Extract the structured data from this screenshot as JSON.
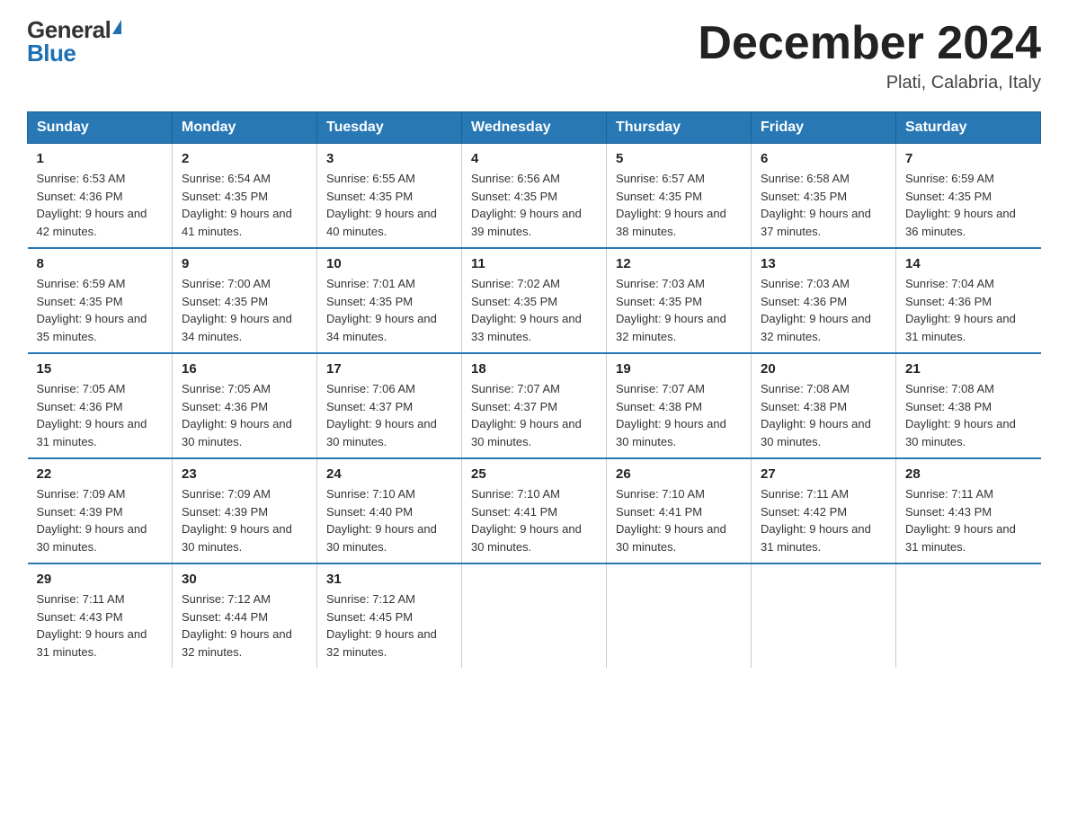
{
  "header": {
    "logo_general": "General",
    "logo_blue": "Blue",
    "month_title": "December 2024",
    "location": "Plati, Calabria, Italy"
  },
  "weekdays": [
    "Sunday",
    "Monday",
    "Tuesday",
    "Wednesday",
    "Thursday",
    "Friday",
    "Saturday"
  ],
  "weeks": [
    [
      {
        "day": "1",
        "sunrise": "6:53 AM",
        "sunset": "4:36 PM",
        "daylight": "9 hours and 42 minutes."
      },
      {
        "day": "2",
        "sunrise": "6:54 AM",
        "sunset": "4:35 PM",
        "daylight": "9 hours and 41 minutes."
      },
      {
        "day": "3",
        "sunrise": "6:55 AM",
        "sunset": "4:35 PM",
        "daylight": "9 hours and 40 minutes."
      },
      {
        "day": "4",
        "sunrise": "6:56 AM",
        "sunset": "4:35 PM",
        "daylight": "9 hours and 39 minutes."
      },
      {
        "day": "5",
        "sunrise": "6:57 AM",
        "sunset": "4:35 PM",
        "daylight": "9 hours and 38 minutes."
      },
      {
        "day": "6",
        "sunrise": "6:58 AM",
        "sunset": "4:35 PM",
        "daylight": "9 hours and 37 minutes."
      },
      {
        "day": "7",
        "sunrise": "6:59 AM",
        "sunset": "4:35 PM",
        "daylight": "9 hours and 36 minutes."
      }
    ],
    [
      {
        "day": "8",
        "sunrise": "6:59 AM",
        "sunset": "4:35 PM",
        "daylight": "9 hours and 35 minutes."
      },
      {
        "day": "9",
        "sunrise": "7:00 AM",
        "sunset": "4:35 PM",
        "daylight": "9 hours and 34 minutes."
      },
      {
        "day": "10",
        "sunrise": "7:01 AM",
        "sunset": "4:35 PM",
        "daylight": "9 hours and 34 minutes."
      },
      {
        "day": "11",
        "sunrise": "7:02 AM",
        "sunset": "4:35 PM",
        "daylight": "9 hours and 33 minutes."
      },
      {
        "day": "12",
        "sunrise": "7:03 AM",
        "sunset": "4:35 PM",
        "daylight": "9 hours and 32 minutes."
      },
      {
        "day": "13",
        "sunrise": "7:03 AM",
        "sunset": "4:36 PM",
        "daylight": "9 hours and 32 minutes."
      },
      {
        "day": "14",
        "sunrise": "7:04 AM",
        "sunset": "4:36 PM",
        "daylight": "9 hours and 31 minutes."
      }
    ],
    [
      {
        "day": "15",
        "sunrise": "7:05 AM",
        "sunset": "4:36 PM",
        "daylight": "9 hours and 31 minutes."
      },
      {
        "day": "16",
        "sunrise": "7:05 AM",
        "sunset": "4:36 PM",
        "daylight": "9 hours and 30 minutes."
      },
      {
        "day": "17",
        "sunrise": "7:06 AM",
        "sunset": "4:37 PM",
        "daylight": "9 hours and 30 minutes."
      },
      {
        "day": "18",
        "sunrise": "7:07 AM",
        "sunset": "4:37 PM",
        "daylight": "9 hours and 30 minutes."
      },
      {
        "day": "19",
        "sunrise": "7:07 AM",
        "sunset": "4:38 PM",
        "daylight": "9 hours and 30 minutes."
      },
      {
        "day": "20",
        "sunrise": "7:08 AM",
        "sunset": "4:38 PM",
        "daylight": "9 hours and 30 minutes."
      },
      {
        "day": "21",
        "sunrise": "7:08 AM",
        "sunset": "4:38 PM",
        "daylight": "9 hours and 30 minutes."
      }
    ],
    [
      {
        "day": "22",
        "sunrise": "7:09 AM",
        "sunset": "4:39 PM",
        "daylight": "9 hours and 30 minutes."
      },
      {
        "day": "23",
        "sunrise": "7:09 AM",
        "sunset": "4:39 PM",
        "daylight": "9 hours and 30 minutes."
      },
      {
        "day": "24",
        "sunrise": "7:10 AM",
        "sunset": "4:40 PM",
        "daylight": "9 hours and 30 minutes."
      },
      {
        "day": "25",
        "sunrise": "7:10 AM",
        "sunset": "4:41 PM",
        "daylight": "9 hours and 30 minutes."
      },
      {
        "day": "26",
        "sunrise": "7:10 AM",
        "sunset": "4:41 PM",
        "daylight": "9 hours and 30 minutes."
      },
      {
        "day": "27",
        "sunrise": "7:11 AM",
        "sunset": "4:42 PM",
        "daylight": "9 hours and 31 minutes."
      },
      {
        "day": "28",
        "sunrise": "7:11 AM",
        "sunset": "4:43 PM",
        "daylight": "9 hours and 31 minutes."
      }
    ],
    [
      {
        "day": "29",
        "sunrise": "7:11 AM",
        "sunset": "4:43 PM",
        "daylight": "9 hours and 31 minutes."
      },
      {
        "day": "30",
        "sunrise": "7:12 AM",
        "sunset": "4:44 PM",
        "daylight": "9 hours and 32 minutes."
      },
      {
        "day": "31",
        "sunrise": "7:12 AM",
        "sunset": "4:45 PM",
        "daylight": "9 hours and 32 minutes."
      },
      null,
      null,
      null,
      null
    ]
  ]
}
